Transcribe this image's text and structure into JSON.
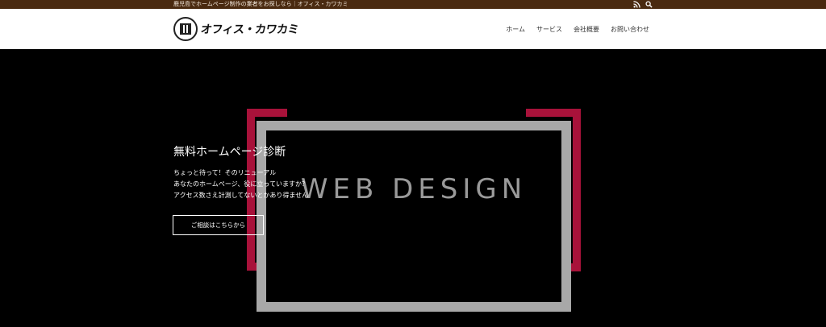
{
  "topbar": {
    "tagline": "鹿児島でホームページ制作の業者をお探しなら｜オフィス・カワカミ",
    "icons": [
      "rss-icon",
      "search-icon"
    ]
  },
  "header": {
    "logo_text": "オフィス・カワカミ",
    "nav": [
      "ホーム",
      "サービス",
      "会社概要",
      "お問い合わせ"
    ]
  },
  "hero": {
    "image_text": "WEB DESIGN",
    "title": "無料ホームページ診断",
    "body": [
      "ちょっと待って！そのリニューアル",
      "あなたのホームページ、役に立っていますか？",
      "アクセス数さえ計測してないとかあり得ません"
    ],
    "cta_label": "ご相談はこちらから"
  },
  "colors": {
    "topbar_bg": "#4a2a10",
    "accent_red": "#a8123a",
    "frame_gray": "#a8a8a8",
    "hero_bg": "#000000"
  }
}
